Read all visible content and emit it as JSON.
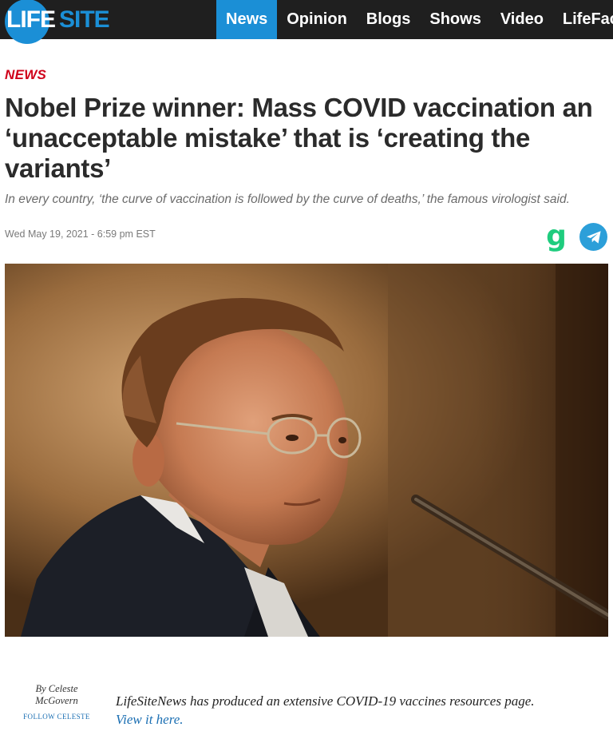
{
  "navbar": {
    "logo_life": "LIFE",
    "logo_site": "SITE",
    "items": [
      "News",
      "Opinion",
      "Blogs",
      "Shows",
      "Video",
      "LifeFact"
    ],
    "active_index": 0
  },
  "article": {
    "category": "NEWS",
    "headline": "Nobel Prize winner: Mass COVID vaccination an ‘unacceptable mistake’ that is ‘creating the variants’",
    "subtitle": "In every country, ‘the curve of vaccination is followed by the curve of deaths,’ the famous virologist said.",
    "date": "Wed May 19, 2021 - 6:59 pm EST"
  },
  "share": {
    "gab_glyph": "g",
    "gab_icon": "gab-icon",
    "telegram_icon": "telegram-icon"
  },
  "byline": {
    "by_line1": "By Celeste",
    "by_line2": "McGovern",
    "follow_label": "FOLLOW CELESTE"
  },
  "body": {
    "text": "LifeSiteNews has produced an extensive COVID-19 vaccines resources page.",
    "link_text": "View it here."
  },
  "colors": {
    "brand_blue": "#1b8fd6",
    "category_red": "#d0021b",
    "gab_green": "#1fcc7e",
    "telegram_blue": "#2c9fd9"
  }
}
